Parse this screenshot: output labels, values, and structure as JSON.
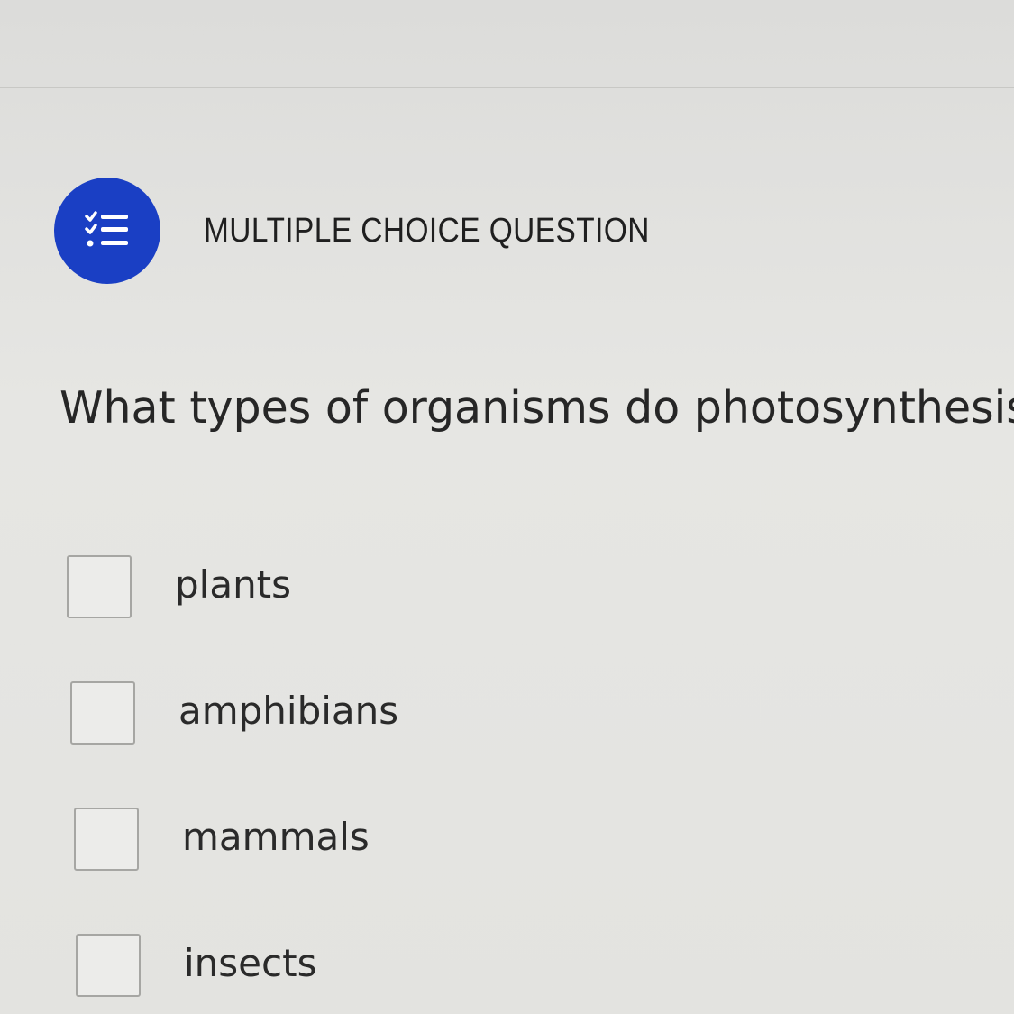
{
  "header": {
    "question_type": "MULTIPLE CHOICE QUESTION",
    "icon": "checklist-icon",
    "accent_color": "#1a3fc4"
  },
  "question": {
    "text": "What types of organisms do photosynthesis?"
  },
  "options": [
    {
      "label": "plants",
      "checked": false
    },
    {
      "label": "amphibians",
      "checked": false
    },
    {
      "label": "mammals",
      "checked": false
    },
    {
      "label": "insects",
      "checked": false
    }
  ]
}
